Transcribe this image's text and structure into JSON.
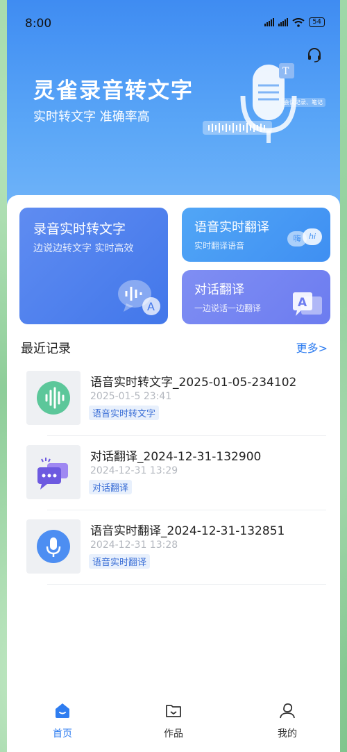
{
  "status_bar": {
    "time": "8:00",
    "battery": "54"
  },
  "hero": {
    "title": "灵雀录音转文字",
    "subtitle": "实时转文字 准确率高",
    "illustration_note": "会议记录、笔记",
    "headset_icon": "headset-icon"
  },
  "features": {
    "main": {
      "title": "录音实时转文字",
      "subtitle": "边说边转文字 实时高效",
      "icon": "voice-to-text-icon"
    },
    "translate": {
      "title": "语音实时翻译",
      "subtitle": "实时翻译语音",
      "badge_left": "嗨",
      "badge_right": "hi",
      "icon": "speech-bubbles-icon"
    },
    "dialogue": {
      "title": "对话翻译",
      "subtitle": "一边说话一边翻译",
      "icon": "translate-icon"
    }
  },
  "recent": {
    "title": "最近记录",
    "more": "更多>",
    "items": [
      {
        "title": "语音实时转文字_2025-01-05-234102",
        "date": "2025-01-5 23:41",
        "tag": "语音实时转文字",
        "icon": "waveform-icon",
        "color": "#5cc79a"
      },
      {
        "title": "对话翻译_2024-12-31-132900",
        "date": "2024-12-31 13:29",
        "tag": "对话翻译",
        "icon": "chat-bubbles-icon",
        "color": "#6d5ae0"
      },
      {
        "title": "语音实时翻译_2024-12-31-132851",
        "date": "2024-12-31 13:28",
        "tag": "语音实时翻译",
        "icon": "microphone-icon",
        "color": "#4d8ef2"
      }
    ]
  },
  "tabbar": {
    "items": [
      {
        "label": "首页",
        "icon": "home-icon",
        "active": true
      },
      {
        "label": "作品",
        "icon": "folder-icon",
        "active": false
      },
      {
        "label": "我的",
        "icon": "profile-icon",
        "active": false
      }
    ]
  },
  "colors": {
    "accent": "#2f7df0",
    "hero": "#3f8cf2"
  }
}
